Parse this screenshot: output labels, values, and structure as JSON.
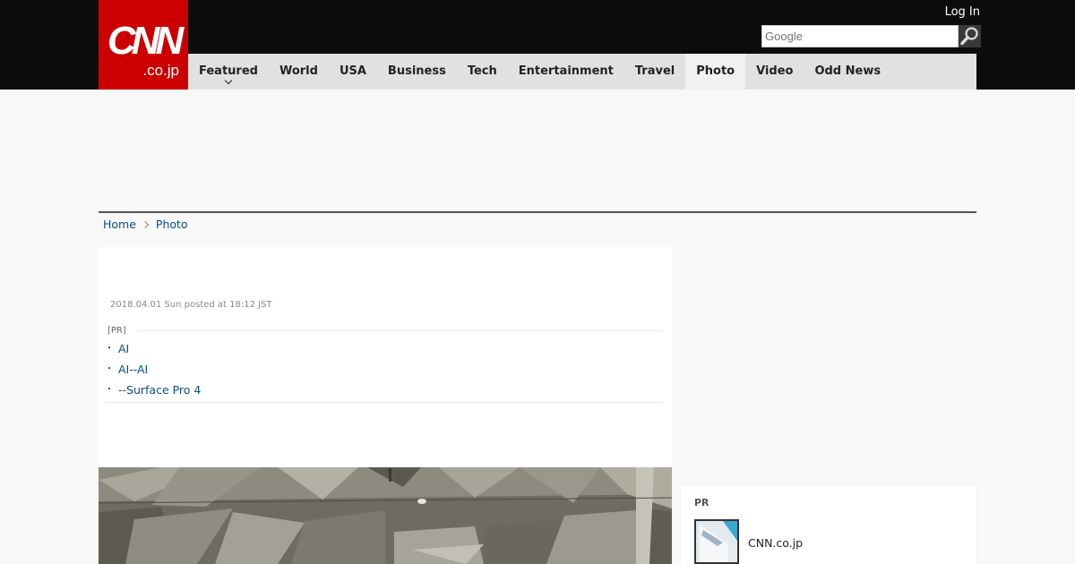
{
  "logo": {
    "main": "CNN",
    "sub": ".co.jp"
  },
  "header": {
    "login": "Log In",
    "search_placeholder": "Google"
  },
  "nav": {
    "items": [
      {
        "label": "Featured"
      },
      {
        "label": "World"
      },
      {
        "label": "USA"
      },
      {
        "label": "Business"
      },
      {
        "label": "Tech"
      },
      {
        "label": "Entertainment"
      },
      {
        "label": "Travel"
      },
      {
        "label": "Photo"
      },
      {
        "label": "Video"
      },
      {
        "label": "Odd News"
      }
    ],
    "active": "Photo"
  },
  "breadcrumb": {
    "home": "Home",
    "current": "Photo"
  },
  "article": {
    "posted": "2018.04.01 Sun posted at 18:12 JST",
    "pr_label": "[PR]",
    "pr_links": [
      "AI",
      "AI--AI",
      "--Surface Pro 4"
    ]
  },
  "sidebar": {
    "pr_label": "PR",
    "item_title": "CNN.co.jp"
  },
  "colors": {
    "logo_red": "#cc0000",
    "header_bg": "#0c0c0c",
    "nav_bg": "#e1e1e1",
    "link": "#0d4e7c"
  }
}
